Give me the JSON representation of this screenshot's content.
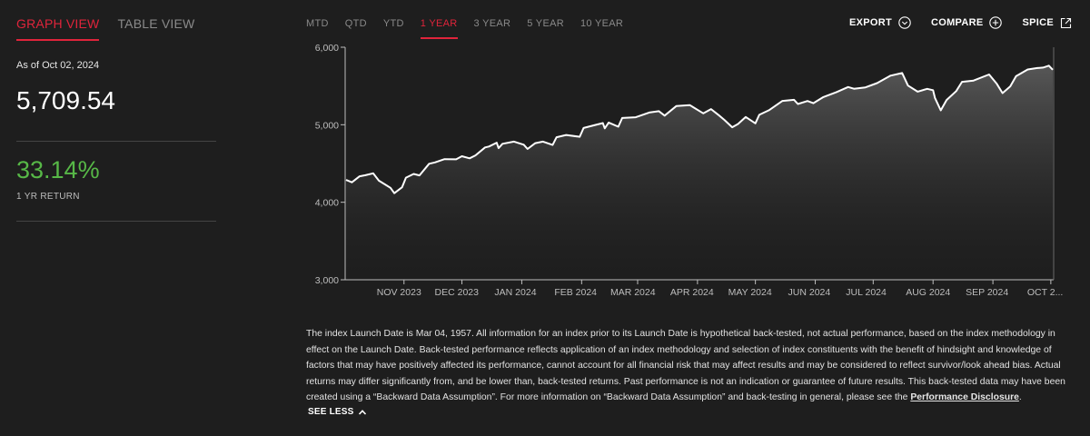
{
  "view_tabs": [
    {
      "label": "GRAPH VIEW",
      "active": true
    },
    {
      "label": "TABLE VIEW",
      "active": false
    }
  ],
  "summary": {
    "as_of": "As of Oct 02, 2024",
    "level": "5,709.54",
    "return_value": "33.14%",
    "return_label": "1 YR RETURN"
  },
  "periods": [
    {
      "label": "MTD",
      "active": false
    },
    {
      "label": "QTD",
      "active": false
    },
    {
      "label": "YTD",
      "active": false
    },
    {
      "label": "1 YEAR",
      "active": true
    },
    {
      "label": "3 YEAR",
      "active": false
    },
    {
      "label": "5 YEAR",
      "active": false
    },
    {
      "label": "10 YEAR",
      "active": false
    }
  ],
  "actions": {
    "export": "EXPORT",
    "compare": "COMPARE",
    "spice": "SPICE"
  },
  "colors": {
    "accent": "#e0243b",
    "positive": "#57b847",
    "line": "#ffffff",
    "background": "#1e1e1e"
  },
  "chart_data": {
    "type": "area",
    "ylim": [
      3000,
      6000
    ],
    "y_ticks": [
      3000,
      4000,
      5000,
      6000
    ],
    "y_tick_labels": [
      "3,000",
      "4,000",
      "5,000",
      "6,000"
    ],
    "x_tick_labels": [
      "NOV 2023",
      "DEC 2023",
      "JAN 2024",
      "FEB 2024",
      "MAR 2024",
      "APR 2024",
      "MAY 2024",
      "JUN 2024",
      "JUL 2024",
      "AUG 2024",
      "SEP 2024",
      "OCT 2..."
    ],
    "x_tick_dates": [
      "2023-11-01",
      "2023-12-01",
      "2024-01-01",
      "2024-02-01",
      "2024-03-01",
      "2024-04-01",
      "2024-05-01",
      "2024-06-01",
      "2024-07-01",
      "2024-08-01",
      "2024-09-01",
      "2024-10-01"
    ],
    "x_range": [
      "2023-10-02",
      "2024-10-02"
    ],
    "series": [
      {
        "points": [
          [
            "2023-10-02",
            4288
          ],
          [
            "2023-10-05",
            4258
          ],
          [
            "2023-10-09",
            4335
          ],
          [
            "2023-10-12",
            4349
          ],
          [
            "2023-10-16",
            4373
          ],
          [
            "2023-10-19",
            4278
          ],
          [
            "2023-10-23",
            4217
          ],
          [
            "2023-10-25",
            4186
          ],
          [
            "2023-10-27",
            4117
          ],
          [
            "2023-10-31",
            4193
          ],
          [
            "2023-11-02",
            4317
          ],
          [
            "2023-11-06",
            4365
          ],
          [
            "2023-11-09",
            4347
          ],
          [
            "2023-11-14",
            4496
          ],
          [
            "2023-11-17",
            4514
          ],
          [
            "2023-11-22",
            4556
          ],
          [
            "2023-11-28",
            4554
          ],
          [
            "2023-12-01",
            4594
          ],
          [
            "2023-12-05",
            4567
          ],
          [
            "2023-12-08",
            4604
          ],
          [
            "2023-12-13",
            4707
          ],
          [
            "2023-12-15",
            4719
          ],
          [
            "2023-12-19",
            4768
          ],
          [
            "2023-12-20",
            4698
          ],
          [
            "2023-12-22",
            4754
          ],
          [
            "2023-12-28",
            4783
          ],
          [
            "2024-01-02",
            4742
          ],
          [
            "2024-01-04",
            4688
          ],
          [
            "2024-01-08",
            4763
          ],
          [
            "2024-01-12",
            4783
          ],
          [
            "2024-01-17",
            4739
          ],
          [
            "2024-01-19",
            4839
          ],
          [
            "2024-01-24",
            4868
          ],
          [
            "2024-01-31",
            4845
          ],
          [
            "2024-02-02",
            4958
          ],
          [
            "2024-02-08",
            4997
          ],
          [
            "2024-02-12",
            5021
          ],
          [
            "2024-02-13",
            4953
          ],
          [
            "2024-02-15",
            5029
          ],
          [
            "2024-02-20",
            4975
          ],
          [
            "2024-02-22",
            5087
          ],
          [
            "2024-02-29",
            5096
          ],
          [
            "2024-03-07",
            5157
          ],
          [
            "2024-03-12",
            5175
          ],
          [
            "2024-03-15",
            5117
          ],
          [
            "2024-03-21",
            5241
          ],
          [
            "2024-03-28",
            5254
          ],
          [
            "2024-04-04",
            5147
          ],
          [
            "2024-04-08",
            5202
          ],
          [
            "2024-04-12",
            5123
          ],
          [
            "2024-04-15",
            5061
          ],
          [
            "2024-04-19",
            4967
          ],
          [
            "2024-04-22",
            5010
          ],
          [
            "2024-04-26",
            5100
          ],
          [
            "2024-05-01",
            5018
          ],
          [
            "2024-05-03",
            5128
          ],
          [
            "2024-05-08",
            5187
          ],
          [
            "2024-05-15",
            5308
          ],
          [
            "2024-05-21",
            5321
          ],
          [
            "2024-05-23",
            5268
          ],
          [
            "2024-05-28",
            5306
          ],
          [
            "2024-05-31",
            5278
          ],
          [
            "2024-06-05",
            5354
          ],
          [
            "2024-06-12",
            5421
          ],
          [
            "2024-06-18",
            5487
          ],
          [
            "2024-06-21",
            5464
          ],
          [
            "2024-06-27",
            5482
          ],
          [
            "2024-07-03",
            5537
          ],
          [
            "2024-07-10",
            5633
          ],
          [
            "2024-07-16",
            5667
          ],
          [
            "2024-07-19",
            5505
          ],
          [
            "2024-07-24",
            5427
          ],
          [
            "2024-07-29",
            5463
          ],
          [
            "2024-08-01",
            5446
          ],
          [
            "2024-08-02",
            5346
          ],
          [
            "2024-08-05",
            5186
          ],
          [
            "2024-08-08",
            5319
          ],
          [
            "2024-08-13",
            5434
          ],
          [
            "2024-08-16",
            5554
          ],
          [
            "2024-08-22",
            5570
          ],
          [
            "2024-08-30",
            5648
          ],
          [
            "2024-09-03",
            5528
          ],
          [
            "2024-09-06",
            5408
          ],
          [
            "2024-09-10",
            5495
          ],
          [
            "2024-09-13",
            5626
          ],
          [
            "2024-09-19",
            5713
          ],
          [
            "2024-09-24",
            5732
          ],
          [
            "2024-09-27",
            5738
          ],
          [
            "2024-09-30",
            5762
          ],
          [
            "2024-10-02",
            5709
          ]
        ]
      }
    ],
    "grid": false
  },
  "disclaimer": {
    "text": "The index Launch Date is Mar 04, 1957. All information for an index prior to its Launch Date is hypothetical back-tested, not actual performance, based on the index methodology in effect on the Launch Date. Back-tested performance reflects application of an index methodology and selection of index constituents with the benefit of hindsight and knowledge of factors that may have positively affected its performance, cannot account for all financial risk that may affect results and may be considered to reflect survivor/look ahead bias. Actual returns may differ significantly from, and be lower than, back-tested returns. Past performance is not an indication or guarantee of future results. This back-tested data may have been created using a “Backward Data Assumption”. For more information on “Backward Data Assumption” and back-testing in general, please see the ",
    "link": "Performance Disclosure",
    "end": ".",
    "toggle": "SEE LESS"
  }
}
